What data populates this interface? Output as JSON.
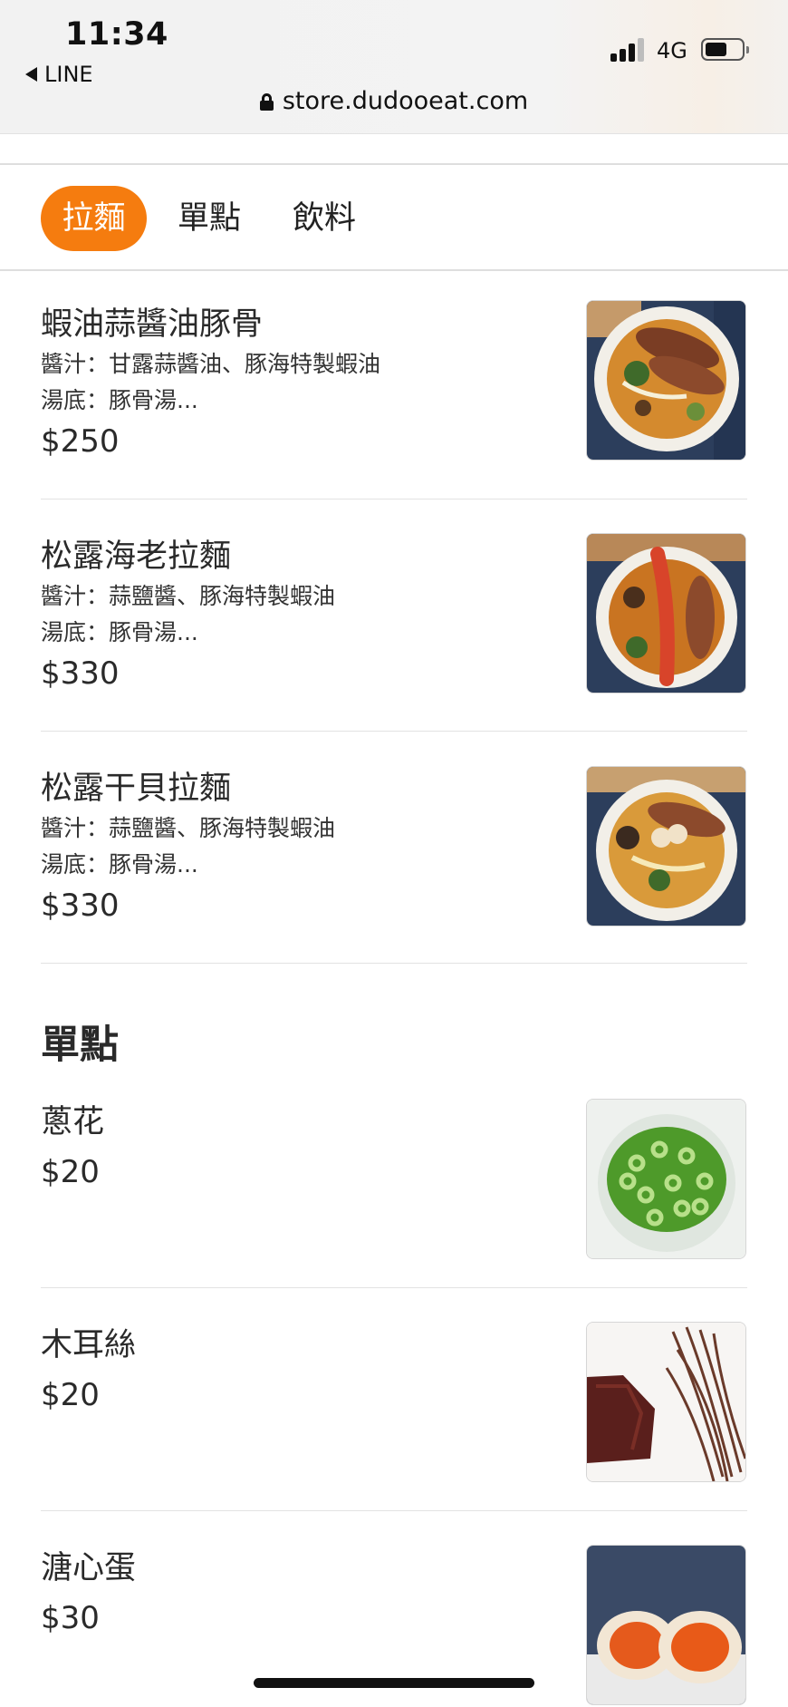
{
  "status": {
    "time": "11:34",
    "back_app": "LINE",
    "network": "4G",
    "url": "store.dudooeat.com"
  },
  "tabs": [
    {
      "label": "拉麵",
      "active": true
    },
    {
      "label": "單點",
      "active": false
    },
    {
      "label": "飲料",
      "active": false
    }
  ],
  "ramen": [
    {
      "name": "蝦油蒜醬油豚骨",
      "sauce": "醬汁：甘露蒜醬油、豚海特製蝦油",
      "soup": "湯底：豚骨湯...",
      "price": "$250"
    },
    {
      "name": "松露海老拉麵",
      "sauce": "醬汁：蒜鹽醬、豚海特製蝦油",
      "soup": "湯底：豚骨湯...",
      "price": "$330"
    },
    {
      "name": "松露干貝拉麵",
      "sauce": "醬汁：蒜鹽醬、豚海特製蝦油",
      "soup": "湯底：豚骨湯...",
      "price": "$330"
    }
  ],
  "section_title": "單點",
  "sides": [
    {
      "name": "蔥花",
      "price": "$20"
    },
    {
      "name": "木耳絲",
      "price": "$20"
    },
    {
      "name": "溏心蛋",
      "price": "$30"
    }
  ],
  "colors": {
    "accent": "#f57c0f"
  }
}
